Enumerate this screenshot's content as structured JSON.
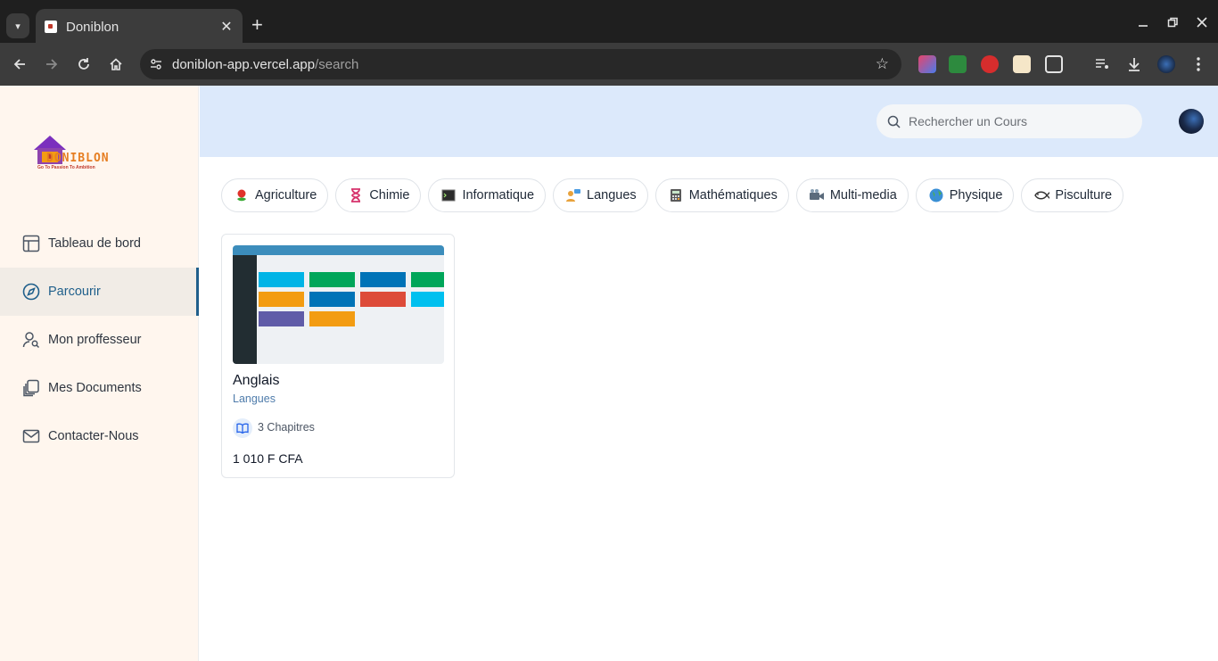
{
  "browser": {
    "tab_title": "Doniblon",
    "url_host": "doniblon-app.vercel.app",
    "url_path": "/search",
    "new_tab_symbol": "+",
    "close_symbol": "✕"
  },
  "logo": {
    "text": "DONIBLON",
    "tagline": "Go To Passion To Ambition"
  },
  "sidebar": {
    "items": [
      {
        "label": "Tableau de bord",
        "icon": "dashboard-icon",
        "active": false
      },
      {
        "label": "Parcourir",
        "icon": "compass-icon",
        "active": true
      },
      {
        "label": "Mon proffesseur",
        "icon": "user-search-icon",
        "active": false
      },
      {
        "label": "Mes Documents",
        "icon": "documents-icon",
        "active": false
      },
      {
        "label": "Contacter-Nous",
        "icon": "mail-icon",
        "active": false
      }
    ]
  },
  "header": {
    "search_placeholder": "Rechercher un Cours"
  },
  "categories": [
    {
      "label": "Agriculture",
      "icon": "rose-icon"
    },
    {
      "label": "Chimie",
      "icon": "hourglass-icon"
    },
    {
      "label": "Informatique",
      "icon": "terminal-icon"
    },
    {
      "label": "Langues",
      "icon": "people-chat-icon"
    },
    {
      "label": "Mathématiques",
      "icon": "calculator-icon"
    },
    {
      "label": "Multi-media",
      "icon": "video-camera-icon"
    },
    {
      "label": "Physique",
      "icon": "globe-icon"
    },
    {
      "label": "Pisculture",
      "icon": "fish-icon"
    }
  ],
  "courses": [
    {
      "title": "Anglais",
      "category": "Langues",
      "chapters": "3 Chapitres",
      "price": "1 010 F CFA"
    }
  ],
  "colors": {
    "sidebar_bg": "#fff6ee",
    "header_bg": "#dce9fb",
    "accent": "#1f5f8b"
  }
}
